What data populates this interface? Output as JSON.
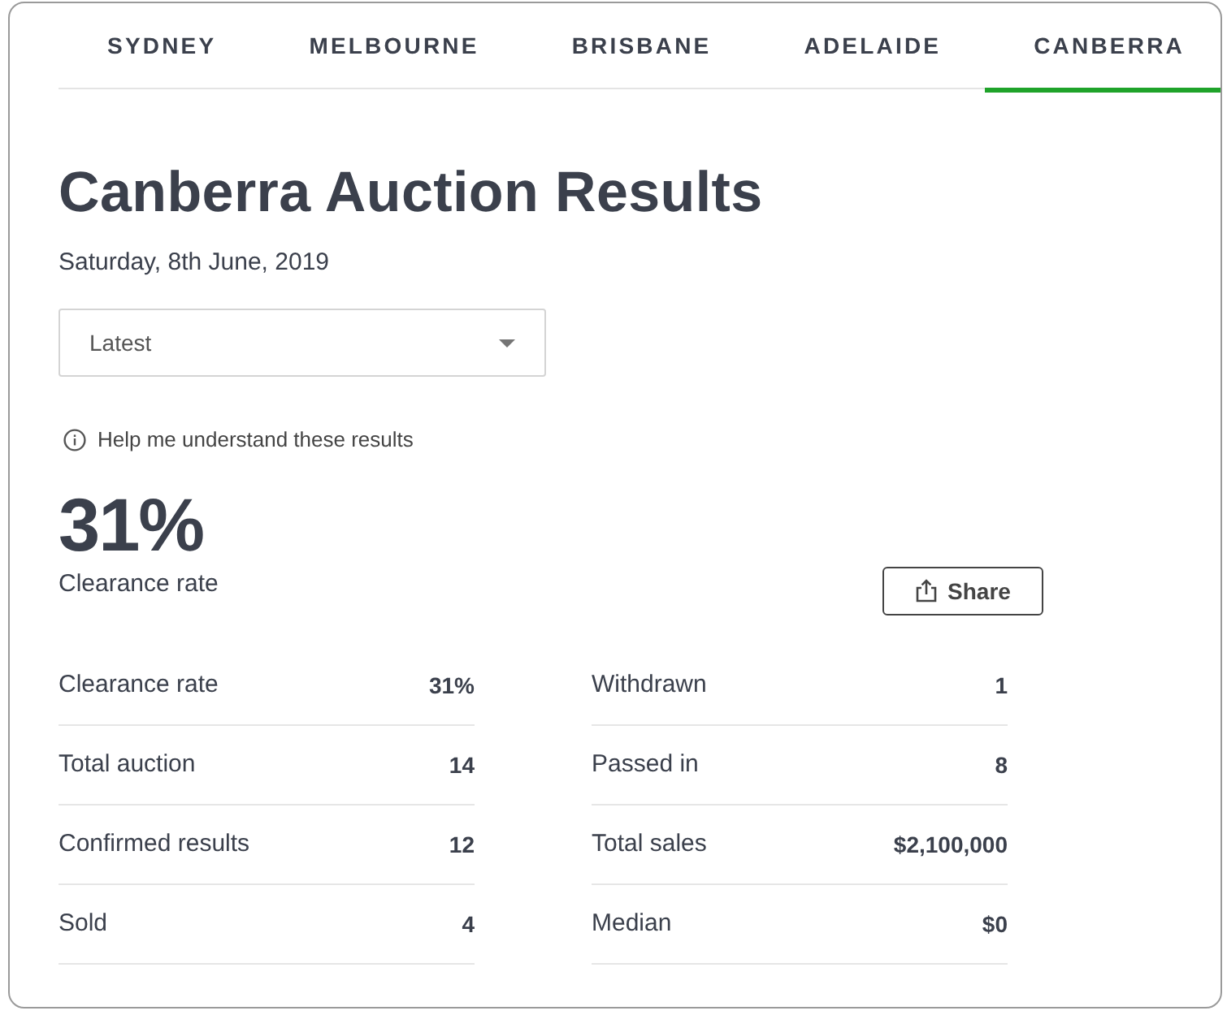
{
  "tabs": [
    {
      "label": "SYDNEY",
      "selected": false
    },
    {
      "label": "MELBOURNE",
      "selected": false
    },
    {
      "label": "BRISBANE",
      "selected": false
    },
    {
      "label": "ADELAIDE",
      "selected": false
    },
    {
      "label": "CANBERRA",
      "selected": true
    }
  ],
  "title": "Canberra Auction Results",
  "date": "Saturday, 8th June, 2019",
  "dropdown": {
    "value": "Latest"
  },
  "help_link": "Help me understand these results",
  "headline": {
    "value": "31%",
    "label": "Clearance rate"
  },
  "share_button": "Share",
  "stats_columns": [
    {
      "rows": [
        {
          "label": "Clearance rate",
          "value": "31%"
        },
        {
          "label": "Total auction",
          "value": "14"
        },
        {
          "label": "Confirmed results",
          "value": "12"
        },
        {
          "label": "Sold",
          "value": "4"
        }
      ]
    },
    {
      "rows": [
        {
          "label": "Withdrawn",
          "value": "1"
        },
        {
          "label": "Passed in",
          "value": "8"
        },
        {
          "label": "Total sales",
          "value": "$2,100,000"
        },
        {
          "label": "Median",
          "value": "$0"
        }
      ]
    }
  ]
}
